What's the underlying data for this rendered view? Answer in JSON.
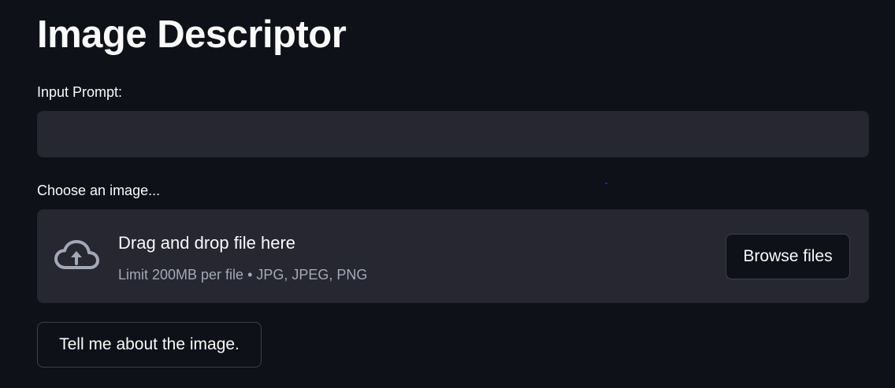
{
  "app": {
    "title": "Image Descriptor"
  },
  "prompt": {
    "label": "Input Prompt:",
    "value": "",
    "placeholder": ""
  },
  "uploader": {
    "label": "Choose an image...",
    "drop_text": "Drag and drop file here",
    "limit_text": "Limit 200MB per file • JPG, JPEG, PNG",
    "browse_label": "Browse files",
    "icon": "cloud-upload-icon"
  },
  "submit": {
    "label": "Tell me about the image."
  },
  "colors": {
    "background": "#0e1117",
    "surface": "#262730",
    "text": "#fafafa",
    "muted_text": "#a3a8b8",
    "button_border": "#3d404a",
    "icon": "#a3a8b8"
  }
}
